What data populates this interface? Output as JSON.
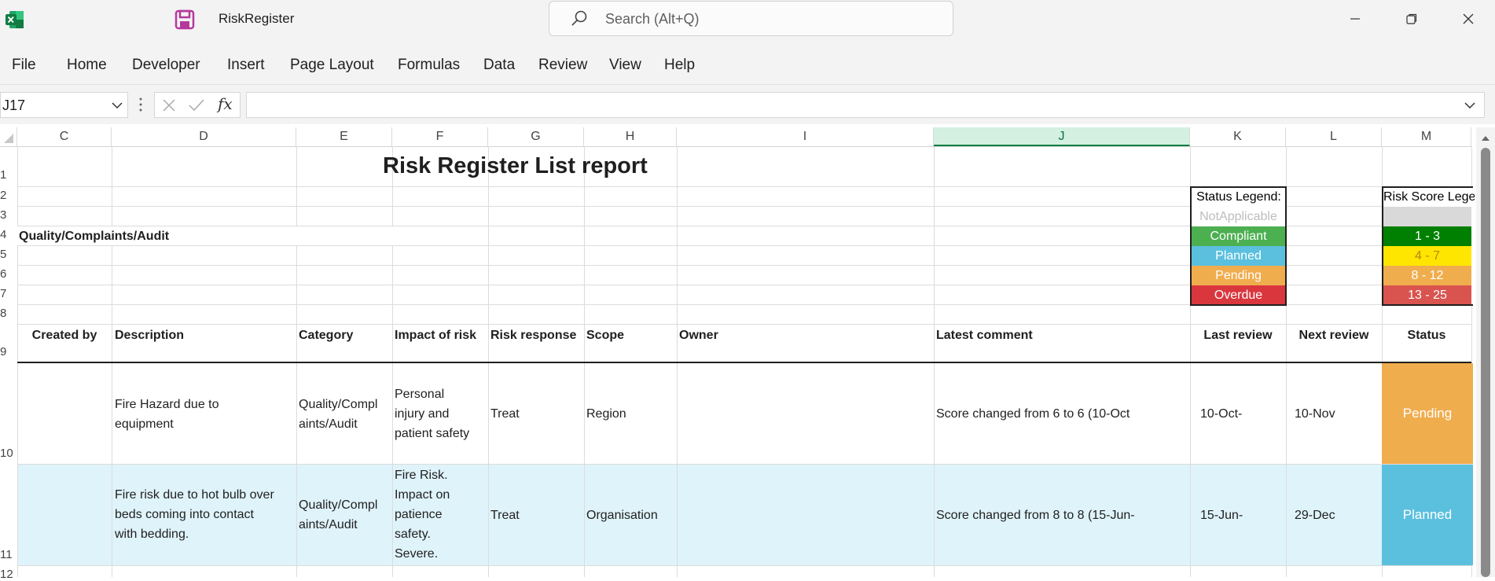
{
  "window": {
    "title": "RiskRegister",
    "search_placeholder": "Search (Alt+Q)"
  },
  "menu": [
    "File",
    "Home",
    "Developer",
    "Insert",
    "Page Layout",
    "Formulas",
    "Data",
    "Review",
    "View",
    "Help"
  ],
  "formula_bar": {
    "name_box": "J17",
    "fx_label": "fx",
    "formula": ""
  },
  "columns": [
    "C",
    "D",
    "E",
    "F",
    "G",
    "H",
    "I",
    "J",
    "K",
    "L",
    "M"
  ],
  "rows": [
    "1",
    "2",
    "3",
    "4",
    "5",
    "6",
    "7",
    "8",
    "9",
    "10",
    "11",
    "12"
  ],
  "sheet": {
    "title": "Risk Register List report",
    "section": "Quality/Complaints/Audit",
    "status_legend": {
      "header": "Status Legend:",
      "items": [
        {
          "label": "NotApplicable",
          "bg": "#ffffff",
          "fg": "#bdbdbd"
        },
        {
          "label": "Compliant",
          "bg": "#4caf50",
          "fg": "#ffffff"
        },
        {
          "label": "Planned",
          "bg": "#5bc0de",
          "fg": "#ffffff"
        },
        {
          "label": "Pending",
          "bg": "#f0ad4e",
          "fg": "#ffffff"
        },
        {
          "label": "Overdue",
          "bg": "#d9363e",
          "fg": "#ffffff"
        }
      ]
    },
    "score_legend": {
      "header": "Risk Score Lege",
      "items": [
        {
          "label": "",
          "bg": "#d9d9d9",
          "fg": "#000000"
        },
        {
          "label": "1 - 3",
          "bg": "#008000",
          "fg": "#ffffff"
        },
        {
          "label": "4 - 7",
          "bg": "#ffe600",
          "fg": "#b8860b"
        },
        {
          "label": "8 - 12",
          "bg": "#f0ad4e",
          "fg": "#ffffff"
        },
        {
          "label": "13 - 25",
          "bg": "#d9534f",
          "fg": "#ffffff"
        }
      ]
    },
    "headers": {
      "created_by": "Created by",
      "description": "Description",
      "category": "Category",
      "impact": "Impact of risk",
      "response": "Risk response",
      "scope": "Scope",
      "owner": "Owner",
      "comment": "Latest comment",
      "last_review": "Last review",
      "next_review": "Next review",
      "status": "Status"
    },
    "records": [
      {
        "created_by": "",
        "description": [
          "Fire Hazard due to",
          "equipment"
        ],
        "category": [
          "Quality/Compl",
          "aints/Audit"
        ],
        "impact": [
          "Personal",
          "injury and",
          "patient safety"
        ],
        "response": "Treat",
        "scope": "Region",
        "owner": "",
        "comment": "Score changed from 6 to 6 (10-Oct",
        "last_review": "10-Oct-",
        "next_review": "10-Nov",
        "status": "Pending",
        "status_bg": "#f0ad4e",
        "row_bg": "#ffffff"
      },
      {
        "created_by": "",
        "description": [
          "Fire risk due to hot bulb over",
          "beds coming into contact",
          "with bedding."
        ],
        "category": [
          "Quality/Compl",
          "aints/Audit"
        ],
        "impact": [
          "Fire Risk.",
          "Impact on",
          "patience",
          "safety.",
          "Severe."
        ],
        "response": "Treat",
        "scope": "Organisation",
        "owner": "",
        "comment": "Score changed from 8 to 8 (15-Jun-",
        "last_review": "15-Jun-",
        "next_review": "29-Dec",
        "status": "Planned",
        "status_bg": "#5bc0de",
        "row_bg": "#dff3fa"
      }
    ]
  }
}
